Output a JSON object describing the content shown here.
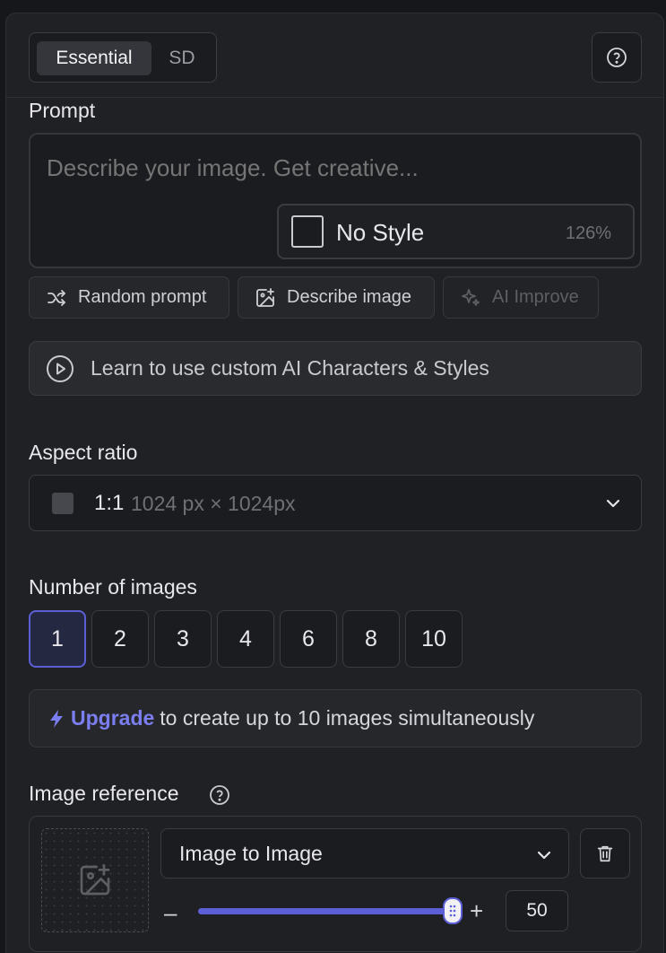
{
  "tabs": {
    "essential": "Essential",
    "sd": "SD"
  },
  "prompt": {
    "label": "Prompt",
    "placeholder": "Describe your image. Get creative...",
    "style_name": "No Style",
    "style_strength": "126%"
  },
  "actions": {
    "random": "Random prompt",
    "describe": "Describe image",
    "improve": "AI Improve"
  },
  "learn": {
    "text": "Learn to use custom AI Characters & Styles"
  },
  "aspect": {
    "label": "Aspect ratio",
    "ratio": "1:1",
    "size": "1024 px × 1024px"
  },
  "images": {
    "label": "Number of images",
    "options": [
      "1",
      "2",
      "3",
      "4",
      "6",
      "8",
      "10"
    ],
    "selected": "1"
  },
  "upgrade": {
    "link": "Upgrade",
    "text": "to create up to 10 images simultaneously"
  },
  "reference": {
    "label": "Image reference",
    "mode": "Image to Image",
    "strength": 50,
    "strength_label": "50",
    "strength_max": 51
  },
  "colors": {
    "accent": "#5c5fd6",
    "link": "#7b7ef0"
  }
}
